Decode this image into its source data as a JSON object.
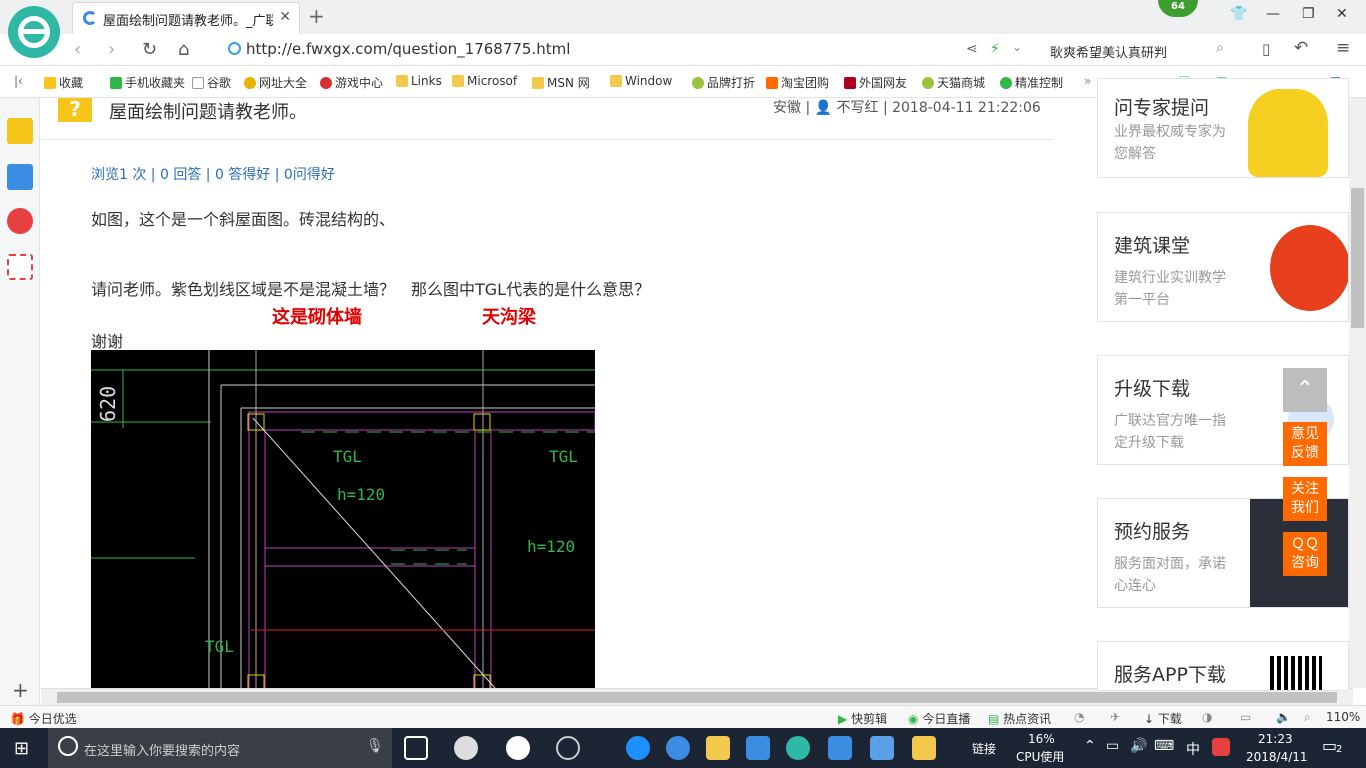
{
  "browser": {
    "tab_title": "屋面绘制问题请教老师。_广联达",
    "badge": "64",
    "url": "http://e.fwxgx.com/question_1768775.html",
    "search_text": "耿爽希望美认真研判",
    "bookmarks": [
      "收藏",
      "手机收藏夹",
      "谷歌",
      "网址大全",
      "游戏中心",
      "Links",
      "Microsof",
      "MSN 网",
      "Window",
      "品牌打折",
      "淘宝团购",
      "外国网友",
      "天猫商城",
      "精准控制"
    ]
  },
  "question": {
    "title": "屋面绘制问题请教老师。",
    "meta": "安徽 | 👤 不写红 | 2018-04-11 21:22:06",
    "stats": "浏览1 次 | 0 回答 | 0 答得好 | 0问得好",
    "para1": "如图，这个是一个斜屋面图。砖混结构的、",
    "para2": "请问老师。紫色划线区域是不是混凝土墙？　那么图中TGL代表的是什么意思？",
    "annotation1": "这是砌体墙",
    "annotation2": "天沟梁",
    "para3": "谢谢",
    "cad": {
      "dim": "620",
      "tgl1": "TGL",
      "tgl2": "TGL",
      "tgl3": "TGL",
      "h1": "h=120",
      "h2": "h=120"
    }
  },
  "sidebar_cards": [
    {
      "title": "问专家提问",
      "desc": "业界最权威专家为您解答"
    },
    {
      "title": "建筑课堂",
      "desc": "建筑行业实训教学第一平台"
    },
    {
      "title": "升级下载",
      "desc": "广联达官方唯一指定升级下载"
    },
    {
      "title": "预约服务",
      "desc": "服务面对面，承诺心连心"
    },
    {
      "title": "服务APP下载",
      "desc": ""
    }
  ],
  "float_buttons": {
    "feedback": "意见\n反馈",
    "follow": "关注\n我们",
    "qq": "ＱＱ\n咨询"
  },
  "statusbar": {
    "left": "今日优选",
    "items": [
      "快剪辑",
      "今日直播",
      "热点资讯",
      "下载"
    ],
    "zoom": "110%"
  },
  "taskbar": {
    "search_placeholder": "在这里输入你要搜索的内容",
    "link": "链接",
    "cpu": "16%",
    "cpu_label": "CPU使用",
    "ime": "中",
    "time": "21:23",
    "date": "2018/4/11",
    "notif": "2"
  }
}
